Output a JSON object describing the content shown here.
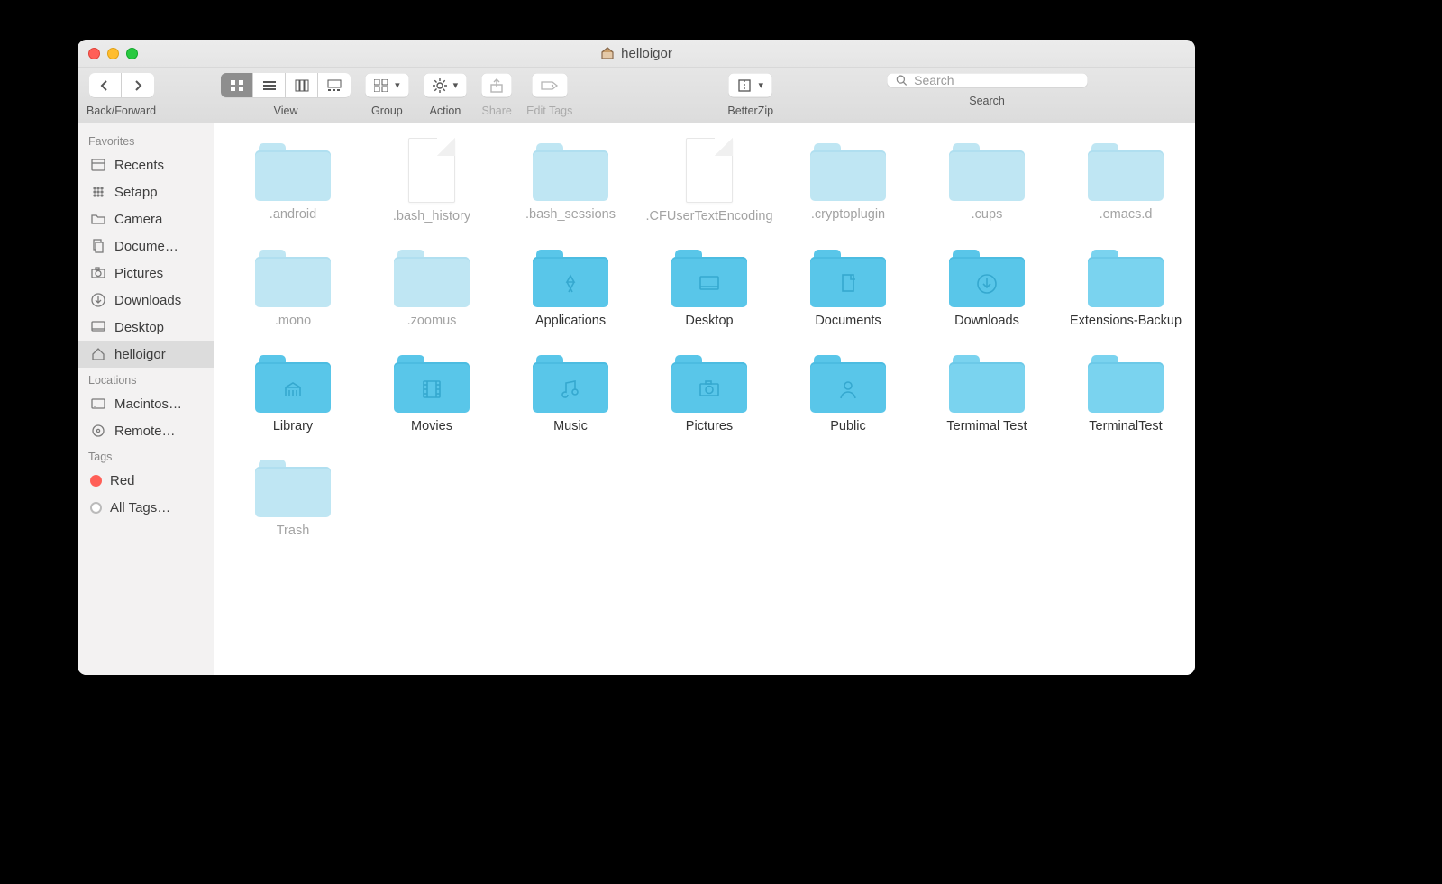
{
  "title": "helloigor",
  "toolbar": {
    "nav_label": "Back/Forward",
    "view_label": "View",
    "group_label": "Group",
    "action_label": "Action",
    "share_label": "Share",
    "edittags_label": "Edit Tags",
    "betterzip_label": "BetterZip",
    "search_label": "Search",
    "search_placeholder": "Search"
  },
  "sidebar": {
    "sections": {
      "favorites": "Favorites",
      "locations": "Locations",
      "tags": "Tags"
    },
    "favorites": [
      {
        "label": "Recents"
      },
      {
        "label": "Setapp"
      },
      {
        "label": "Camera"
      },
      {
        "label": "Docume…"
      },
      {
        "label": "Pictures"
      },
      {
        "label": "Downloads"
      },
      {
        "label": "Desktop"
      },
      {
        "label": "helloigor"
      }
    ],
    "locations": [
      {
        "label": "Macintos…"
      },
      {
        "label": "Remote…"
      }
    ],
    "tags": [
      {
        "label": "Red"
      },
      {
        "label": "All Tags…"
      }
    ]
  },
  "items": [
    {
      "name": ".android",
      "type": "folder",
      "hidden": true,
      "glyph": ""
    },
    {
      "name": ".bash_history",
      "type": "file",
      "hidden": true
    },
    {
      "name": ".bash_sessions",
      "type": "folder",
      "hidden": true,
      "glyph": ""
    },
    {
      "name": ".CFUserTextEncoding",
      "type": "file",
      "hidden": true
    },
    {
      "name": ".cryptoplugin",
      "type": "folder",
      "hidden": true,
      "glyph": ""
    },
    {
      "name": ".cups",
      "type": "folder",
      "hidden": true,
      "glyph": ""
    },
    {
      "name": ".emacs.d",
      "type": "folder",
      "hidden": true,
      "glyph": ""
    },
    {
      "name": ".mono",
      "type": "folder",
      "hidden": true,
      "glyph": ""
    },
    {
      "name": ".zoomus",
      "type": "folder",
      "hidden": true,
      "glyph": ""
    },
    {
      "name": "Applications",
      "type": "folder",
      "hidden": false,
      "style": "system",
      "glyph": "apps"
    },
    {
      "name": "Desktop",
      "type": "folder",
      "hidden": false,
      "style": "system",
      "glyph": "desktop"
    },
    {
      "name": "Documents",
      "type": "folder",
      "hidden": false,
      "style": "system",
      "glyph": "doc"
    },
    {
      "name": "Downloads",
      "type": "folder",
      "hidden": false,
      "style": "system",
      "glyph": "download"
    },
    {
      "name": "Extensions-Backup",
      "type": "folder",
      "hidden": false,
      "style": "normal",
      "glyph": ""
    },
    {
      "name": "Library",
      "type": "folder",
      "hidden": false,
      "style": "system",
      "glyph": "library"
    },
    {
      "name": "Movies",
      "type": "folder",
      "hidden": false,
      "style": "system",
      "glyph": "movies"
    },
    {
      "name": "Music",
      "type": "folder",
      "hidden": false,
      "style": "system",
      "glyph": "music"
    },
    {
      "name": "Pictures",
      "type": "folder",
      "hidden": false,
      "style": "system",
      "glyph": "pictures"
    },
    {
      "name": "Public",
      "type": "folder",
      "hidden": false,
      "style": "system",
      "glyph": "public"
    },
    {
      "name": "Termimal Test",
      "type": "folder",
      "hidden": false,
      "style": "normal",
      "glyph": ""
    },
    {
      "name": "TerminalTest",
      "type": "folder",
      "hidden": false,
      "style": "normal",
      "glyph": ""
    },
    {
      "name": "Trash",
      "type": "folder",
      "hidden": true,
      "glyph": ""
    }
  ]
}
